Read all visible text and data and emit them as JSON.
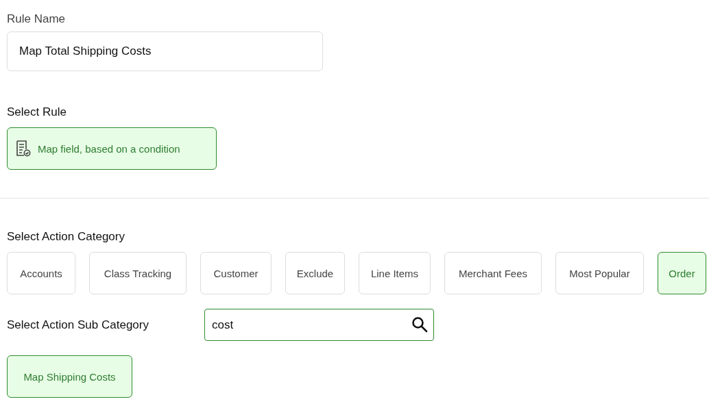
{
  "rule_name": {
    "label": "Rule Name",
    "value": "Map Total Shipping Costs"
  },
  "select_rule": {
    "label": "Select Rule",
    "options": [
      {
        "label": "Map field, based on a condition",
        "selected": true
      }
    ]
  },
  "action_category": {
    "label": "Select Action Category",
    "options": [
      {
        "label": "Accounts",
        "selected": false
      },
      {
        "label": "Class Tracking",
        "selected": false
      },
      {
        "label": "Customer",
        "selected": false
      },
      {
        "label": "Exclude",
        "selected": false
      },
      {
        "label": "Line Items",
        "selected": false
      },
      {
        "label": "Merchant Fees",
        "selected": false
      },
      {
        "label": "Most Popular",
        "selected": false
      },
      {
        "label": "Order",
        "selected": true
      }
    ]
  },
  "action_sub_category": {
    "label": "Select Action Sub Category",
    "search": {
      "value": "cost"
    },
    "options": [
      {
        "label": "Map Shipping Costs",
        "selected": true
      }
    ]
  }
}
